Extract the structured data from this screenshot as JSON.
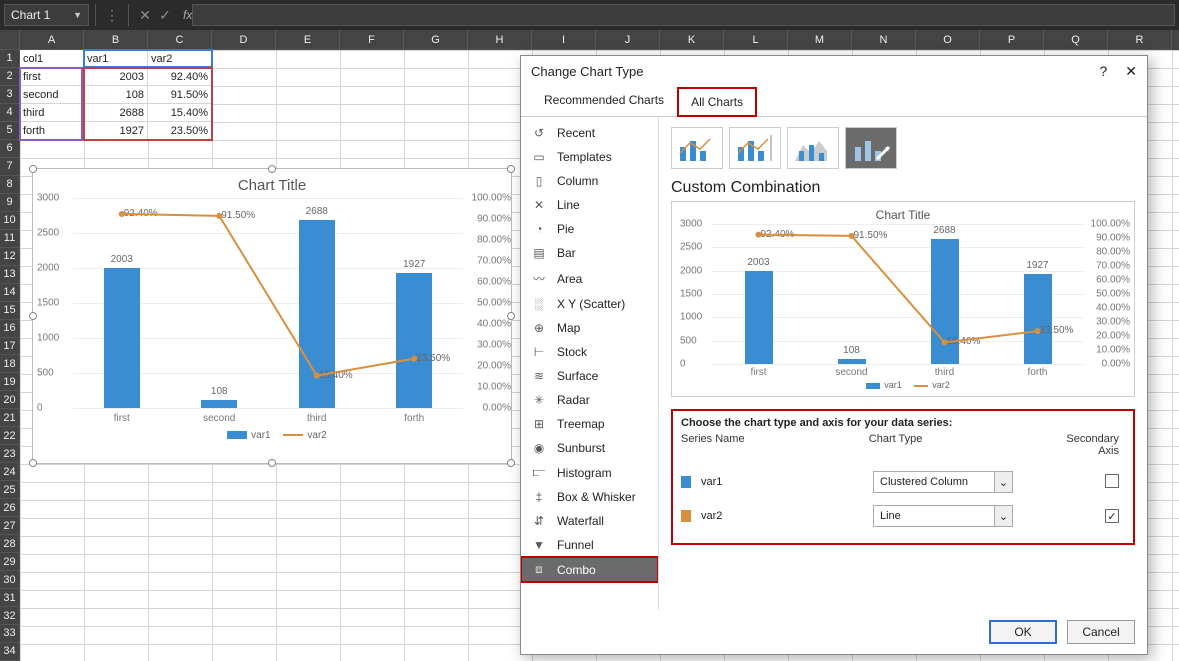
{
  "topbar": {
    "namebox": "Chart 1",
    "fx": "fx"
  },
  "columns": [
    "A",
    "B",
    "C",
    "D",
    "E",
    "F",
    "G",
    "H",
    "I",
    "J",
    "K",
    "L",
    "M",
    "N",
    "O",
    "P",
    "Q",
    "R"
  ],
  "rows_visible": 34,
  "sheet": {
    "headers": [
      "col1",
      "var1",
      "var2"
    ],
    "rows": [
      {
        "c0": "first",
        "c1": "2003",
        "c2": "92.40%"
      },
      {
        "c0": "second",
        "c1": "108",
        "c2": "91.50%"
      },
      {
        "c0": "third",
        "c1": "2688",
        "c2": "15.40%"
      },
      {
        "c0": "forth",
        "c1": "1927",
        "c2": "23.50%"
      }
    ]
  },
  "chart_data": [
    {
      "type": "bar",
      "title": "Chart Title",
      "categories": [
        "first",
        "second",
        "third",
        "forth"
      ],
      "series": [
        {
          "name": "var1",
          "type": "bar",
          "values": [
            2003,
            108,
            2688,
            1927
          ],
          "axis": "primary"
        },
        {
          "name": "var2",
          "type": "line",
          "values": [
            92.4,
            91.5,
            15.4,
            23.5
          ],
          "axis": "secondary",
          "labels": [
            "92.40%",
            "91.50%",
            "15.40%",
            "23.50%"
          ]
        }
      ],
      "ylim_primary": [
        0,
        3000
      ],
      "ylim_secondary": [
        0,
        100
      ],
      "y_ticks_primary": [
        "0",
        "500",
        "1000",
        "1500",
        "2000",
        "2500",
        "3000"
      ],
      "y_ticks_secondary": [
        "0.00%",
        "10.00%",
        "20.00%",
        "30.00%",
        "40.00%",
        "50.00%",
        "60.00%",
        "70.00%",
        "80.00%",
        "90.00%",
        "100.00%"
      ]
    }
  ],
  "dialog": {
    "title": "Change Chart Type",
    "tabs": {
      "recommended": "Recommended Charts",
      "all": "All Charts"
    },
    "types": [
      {
        "icon": "↺",
        "label": "Recent"
      },
      {
        "icon": "▭",
        "label": "Templates"
      },
      {
        "icon": "▯",
        "label": "Column"
      },
      {
        "icon": "✕",
        "label": "Line"
      },
      {
        "icon": "◔",
        "label": "Pie"
      },
      {
        "icon": "▤",
        "label": "Bar"
      },
      {
        "icon": "〰",
        "label": "Area"
      },
      {
        "icon": "░",
        "label": "X Y (Scatter)"
      },
      {
        "icon": "⊕",
        "label": "Map"
      },
      {
        "icon": "⊢",
        "label": "Stock"
      },
      {
        "icon": "≋",
        "label": "Surface"
      },
      {
        "icon": "✳",
        "label": "Radar"
      },
      {
        "icon": "⊞",
        "label": "Treemap"
      },
      {
        "icon": "◉",
        "label": "Sunburst"
      },
      {
        "icon": "⫍",
        "label": "Histogram"
      },
      {
        "icon": "‡",
        "label": "Box & Whisker"
      },
      {
        "icon": "⇵",
        "label": "Waterfall"
      },
      {
        "icon": "▼",
        "label": "Funnel"
      },
      {
        "icon": "⧈",
        "label": "Combo"
      }
    ],
    "custom_label": "Custom Combination",
    "series_panel": {
      "instruction": "Choose the chart type and axis for your data series:",
      "h1": "Series Name",
      "h2": "Chart Type",
      "h3": "Secondary Axis",
      "rows": [
        {
          "name": "var1",
          "color": "#3a8dd0",
          "type": "Clustered Column",
          "secondary": false
        },
        {
          "name": "var2",
          "color": "#d98f3e",
          "type": "Line",
          "secondary": true
        }
      ]
    },
    "buttons": {
      "ok": "OK",
      "cancel": "Cancel"
    }
  },
  "legend": {
    "s1": "var1",
    "s2": "var2"
  }
}
